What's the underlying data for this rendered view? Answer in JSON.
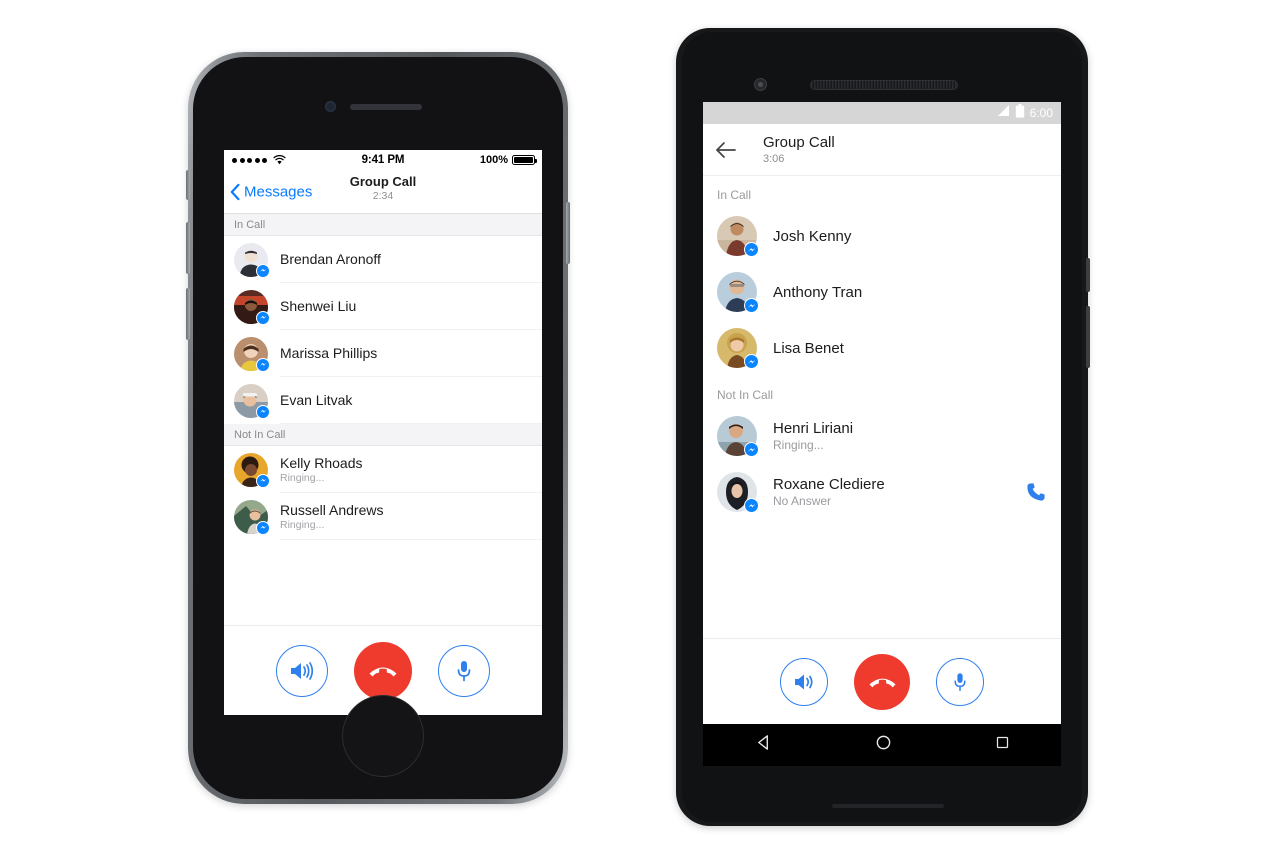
{
  "ios": {
    "status_bar": {
      "signal_dots": 5,
      "wifi_icon": "wifi-icon",
      "time": "9:41 PM",
      "battery_percent": "100%"
    },
    "nav": {
      "back_label": "Messages",
      "back_icon": "chevron-left-icon",
      "title": "Group Call",
      "duration": "2:34"
    },
    "sections": [
      {
        "header": "In Call",
        "rows": [
          {
            "name": "Brendan Aronoff",
            "status": "",
            "badge": "messenger-badge-icon",
            "avatar_colors": [
              "#e8eaef",
              "#2c2f36"
            ]
          },
          {
            "name": "Shenwei Liu",
            "status": "",
            "badge": "messenger-badge-icon",
            "avatar_colors": [
              "#5a2b22",
              "#c4452a"
            ]
          },
          {
            "name": "Marissa Phillips",
            "status": "",
            "badge": "messenger-badge-icon",
            "avatar_colors": [
              "#b98f6e",
              "#e8c63e"
            ]
          },
          {
            "name": "Evan Litvak",
            "status": "",
            "badge": "messenger-badge-icon",
            "avatar_colors": [
              "#d9cfc4",
              "#8d9aa6"
            ]
          }
        ]
      },
      {
        "header": "Not In Call",
        "rows": [
          {
            "name": "Kelly Rhoads",
            "status": "Ringing...",
            "badge": "messenger-badge-icon",
            "avatar_colors": [
              "#e8a72b",
              "#3a2418"
            ]
          },
          {
            "name": "Russell Andrews",
            "status": "Ringing...",
            "badge": "messenger-badge-icon",
            "avatar_colors": [
              "#3e5c4a",
              "#96a88c"
            ]
          }
        ]
      }
    ],
    "controls": [
      {
        "name": "speaker",
        "icon": "speaker-icon",
        "style": "outline"
      },
      {
        "name": "end-call",
        "icon": "end-call-icon",
        "style": "end"
      },
      {
        "name": "microphone",
        "icon": "microphone-icon",
        "style": "outline"
      }
    ]
  },
  "android": {
    "status_bar": {
      "signal_icon": "signal-icon",
      "battery_icon": "battery-icon",
      "time": "6:00"
    },
    "appbar": {
      "back_icon": "arrow-back-icon",
      "title": "Group Call",
      "duration": "3:06"
    },
    "sections": [
      {
        "header": "In Call",
        "rows": [
          {
            "name": "Josh Kenny",
            "status": "",
            "badge": "messenger-badge-icon",
            "avatar_colors": [
              "#d8c9b4",
              "#7a3b2e"
            ],
            "redial": false
          },
          {
            "name": "Anthony Tran",
            "status": "",
            "badge": "messenger-badge-icon",
            "avatar_colors": [
              "#b9cddd",
              "#2c3d55"
            ],
            "redial": false
          },
          {
            "name": "Lisa Benet",
            "status": "",
            "badge": "messenger-badge-icon",
            "avatar_colors": [
              "#d6b96a",
              "#7a4a22"
            ],
            "redial": false
          }
        ]
      },
      {
        "header": "Not In Call",
        "rows": [
          {
            "name": "Henri Liriani",
            "status": "Ringing...",
            "badge": "messenger-badge-icon",
            "avatar_colors": [
              "#b8cad6",
              "#5b4236"
            ],
            "redial": false
          },
          {
            "name": "Roxane Clediere",
            "status": "No Answer",
            "badge": "messenger-badge-icon",
            "avatar_colors": [
              "#dfe4e8",
              "#1d1f24"
            ],
            "redial": true,
            "redial_icon": "phone-icon"
          }
        ]
      }
    ],
    "controls": [
      {
        "name": "speaker",
        "icon": "speaker-icon",
        "style": "outline"
      },
      {
        "name": "end-call",
        "icon": "end-call-icon",
        "style": "end"
      },
      {
        "name": "microphone",
        "icon": "microphone-icon",
        "style": "outline"
      }
    ],
    "nav_buttons": [
      {
        "name": "back",
        "icon": "triangle-back-icon"
      },
      {
        "name": "home",
        "icon": "circle-home-icon"
      },
      {
        "name": "recents",
        "icon": "square-recents-icon"
      }
    ]
  },
  "colors": {
    "accent_blue": "#2f80ed",
    "ios_blue": "#0a7cff",
    "end_red": "#ef3b2d",
    "messenger_blue": "#0a84ff",
    "section_gray": "#8a8a8e"
  }
}
